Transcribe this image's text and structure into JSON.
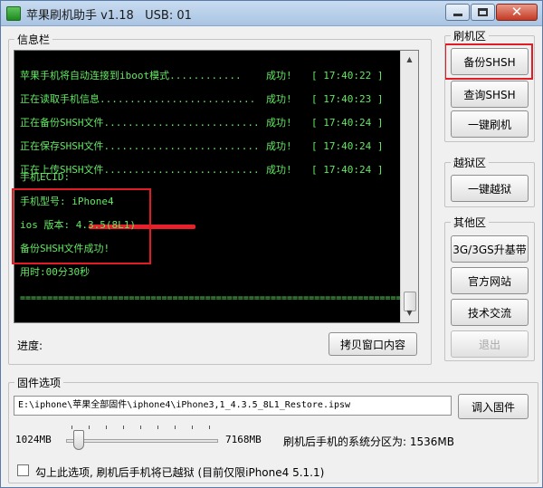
{
  "window": {
    "title": "苹果刷机助手 v1.18   USB: 01"
  },
  "info_panel": {
    "label": "信息栏",
    "log": [
      {
        "text": "苹果手机将自动连接到iboot模式............",
        "status": "成功!",
        "time": "[ 17:40:22 ]"
      },
      {
        "text": "正在读取手机信息..........................",
        "status": "成功!",
        "time": "[ 17:40:23 ]"
      },
      {
        "text": "正在备份SHSH文件..........................",
        "status": "成功!",
        "time": "[ 17:40:24 ]"
      },
      {
        "text": "正在保存SHSH文件..........................",
        "status": "成功!",
        "time": "[ 17:40:24 ]"
      },
      {
        "text": "正在上传SHSH文件..........................",
        "status": "成功!",
        "time": "[ 17:40:24 ]"
      }
    ],
    "ecid_label": "手机ECID:",
    "model": "手机型号: iPhone4",
    "ios_version": "ios 版本: 4.3.5(8L1)",
    "backup_result": "备份SHSH文件成功!",
    "elapsed": "用时:00分30秒",
    "separator": "========================================================================================"
  },
  "progress": {
    "label": "进度:",
    "copy_button": "拷贝窗口内容"
  },
  "flash_area": {
    "label": "刷机区",
    "backup_shsh": "备份SHSH",
    "query_shsh": "查询SHSH",
    "one_click_flash": "一键刷机"
  },
  "jailbreak_area": {
    "label": "越狱区",
    "one_click_jailbreak": "一键越狱"
  },
  "other_area": {
    "label": "其他区",
    "upgrade_baseband": "3G/3GS升基带",
    "official_site": "官方网站",
    "tech_exchange": "技术交流",
    "exit": "退出"
  },
  "firmware": {
    "label": "固件选项",
    "path": "E:\\iphone\\苹果全部固件\\iphone4\\iPhone3,1_4.3.5_8L1_Restore.ipsw",
    "import_button": "调入固件",
    "slider_min": "1024MB",
    "slider_max": "7168MB",
    "partition_text": "刷机后手机的系统分区为: 1536MB",
    "slider_value_mb": 1536,
    "jailbreak_option": "勾上此选项, 刷机后手机将已越狱 (目前仅限iPhone4 5.1.1)",
    "jailbreak_checked": false
  },
  "colors": {
    "console_bg": "#000000",
    "console_text": "#62e862",
    "highlight": "#e21c24"
  }
}
